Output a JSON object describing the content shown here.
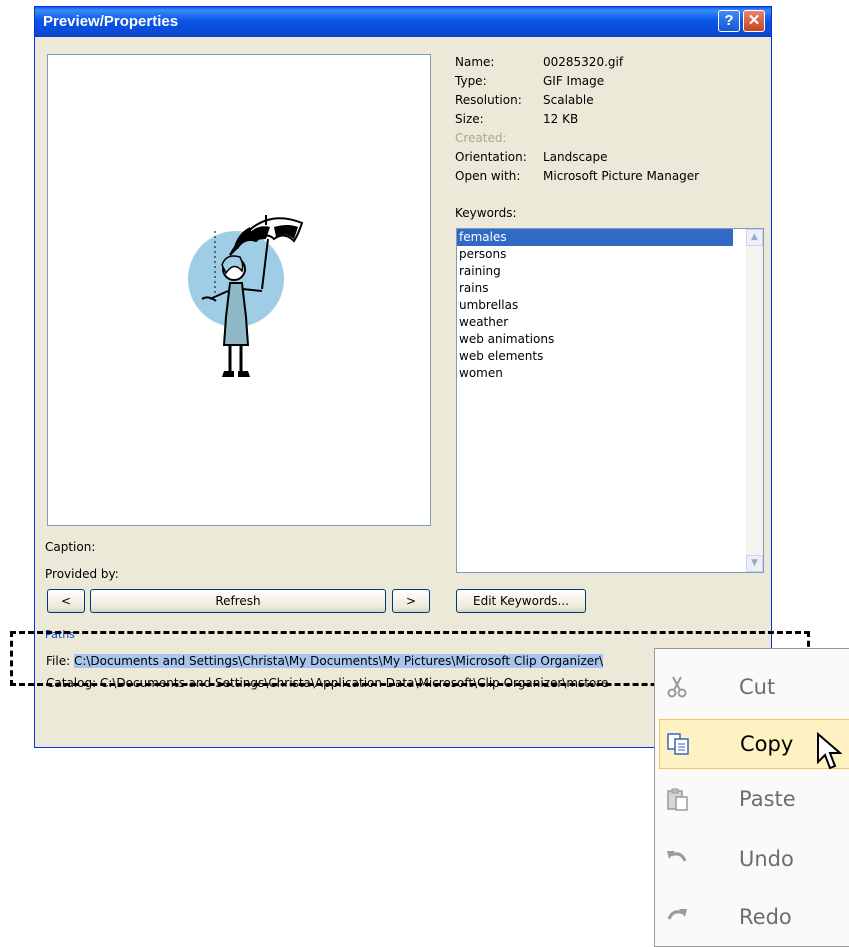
{
  "window": {
    "title": "Preview/Properties",
    "help_button": "?",
    "close_button": "✕"
  },
  "properties": [
    {
      "label": "Name:",
      "value": "00285320.gif",
      "disabled": false
    },
    {
      "label": "Type:",
      "value": "GIF Image",
      "disabled": false
    },
    {
      "label": "Resolution:",
      "value": "Scalable",
      "disabled": false
    },
    {
      "label": "Size:",
      "value": "12 KB",
      "disabled": false
    },
    {
      "label": "Created:",
      "value": "",
      "disabled": true
    },
    {
      "label": "Orientation:",
      "value": "Landscape",
      "disabled": false
    },
    {
      "label": "Open with:",
      "value": "Microsoft Picture Manager",
      "disabled": false
    }
  ],
  "keywords": {
    "label": "Keywords:",
    "items": [
      "females",
      "persons",
      "raining",
      "rains",
      "umbrellas",
      "weather",
      "web animations",
      "web elements",
      "women"
    ],
    "selected": 0
  },
  "caption_label": "Caption:",
  "provided_by_label": "Provided by:",
  "buttons": {
    "prev": "<",
    "refresh": "Refresh",
    "next": ">",
    "edit_keywords": "Edit Keywords..."
  },
  "paths": {
    "title": "Paths",
    "file_label": "File:",
    "file_value": "C:\\Documents and Settings\\Christa\\My Documents\\My Pictures\\Microsoft Clip Organizer\\",
    "catalog_label": "Catalog:",
    "catalog_value": "C:\\Documents and Settings\\Christa\\Application Data\\Microsoft\\Clip Organizer\\mstore"
  },
  "context_menu": [
    {
      "label": "Cut",
      "icon": "scissors-icon",
      "enabled": false,
      "highlighted": false
    },
    {
      "label": "Copy",
      "icon": "copy-icon",
      "enabled": true,
      "highlighted": true
    },
    {
      "label": "Paste",
      "icon": "paste-icon",
      "enabled": false,
      "highlighted": false
    },
    {
      "label": "Undo",
      "icon": "undo-icon",
      "enabled": false,
      "highlighted": false
    },
    {
      "label": "Redo",
      "icon": "redo-icon",
      "enabled": false,
      "highlighted": false
    }
  ],
  "colors": {
    "title_bar": "#0a4ad6",
    "selection": "#316ac5",
    "menu_highlight": "#fff2c2",
    "clipart_circle": "#9fcde6"
  }
}
